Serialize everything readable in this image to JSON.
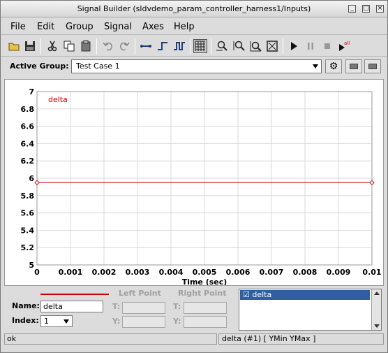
{
  "window": {
    "title": "Signal Builder (sldvdemo_param_controller_harness1/Inputs)"
  },
  "menu": [
    "File",
    "Edit",
    "Group",
    "Signal",
    "Axes",
    "Help"
  ],
  "toolbar": {
    "icons": [
      "open-icon",
      "save-icon",
      "cut-icon",
      "copy-icon",
      "paste-icon",
      "undo-icon",
      "redo-icon",
      "line-segment-icon",
      "step-segment-icon",
      "pulse-segment-icon",
      "grid-icon",
      "zoom-x-icon",
      "zoom-y-icon",
      "zoom-xy-icon",
      "fit-view-icon",
      "play-icon",
      "pause-icon",
      "stop-icon",
      "play-all-icon"
    ],
    "play_all_badge": "all"
  },
  "active_group": {
    "label": "Active Group:",
    "value": "Test Case 1"
  },
  "chart_data": {
    "type": "line",
    "series": [
      {
        "name": "delta",
        "x": [
          0,
          0.01
        ],
        "y": [
          5.95,
          5.95
        ],
        "color": "#cc0000"
      }
    ],
    "xlabel": "Time (sec)",
    "ylabel": "",
    "xlim": [
      0,
      0.01
    ],
    "ylim": [
      5,
      7
    ],
    "x_ticks": [
      "0",
      "0.001",
      "0.002",
      "0.003",
      "0.004",
      "0.005",
      "0.006",
      "0.007",
      "0.008",
      "0.009",
      "0.01"
    ],
    "y_ticks": [
      "5",
      "5.2",
      "5.4",
      "5.6",
      "5.8",
      "6",
      "6.2",
      "6.4",
      "6.6",
      "6.8",
      "7"
    ],
    "grid": true,
    "legend": "top-left"
  },
  "editor": {
    "left_point": "Left Point",
    "right_point": "Right Point",
    "name_label": "Name:",
    "name_value": "delta",
    "index_label": "Index:",
    "index_value": "1",
    "t_label": "T:",
    "y_label": "Y:"
  },
  "signal_list": [
    {
      "label": "☑ delta",
      "selected": true
    }
  ],
  "status": {
    "left": "ok",
    "right": "delta (#1)  [ YMin YMax ]"
  }
}
